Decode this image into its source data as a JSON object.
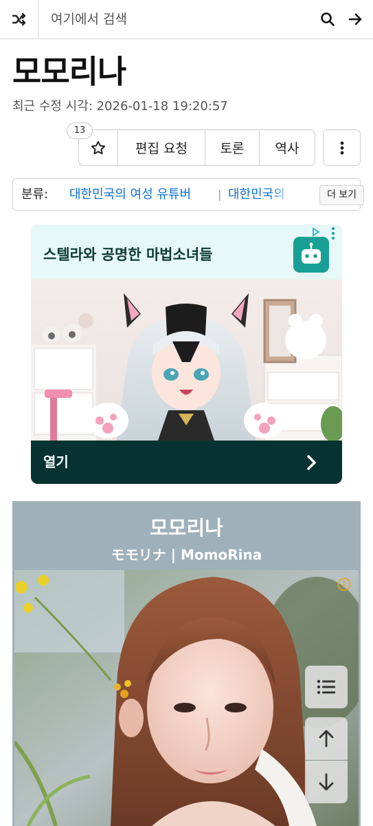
{
  "search": {
    "placeholder": "여기에서 검색"
  },
  "page": {
    "title": "모모리나",
    "last_modified": "최근 수정 시각: 2026-01-18 19:20:57"
  },
  "actions": {
    "star_count": "13",
    "edit_request": "편집 요청",
    "discussion": "토론",
    "history": "역사"
  },
  "category": {
    "label": "분류:",
    "items": [
      "대한민국의 여성 유튜버",
      "대한민국의"
    ],
    "separator": "|",
    "more": "더 보기"
  },
  "ad": {
    "title": "스텔라와 공명한 마법소녀들",
    "cta": "열기"
  },
  "infobox": {
    "name": "모모리나",
    "subtitle": "モモリナ | MomoRina"
  },
  "icons": [
    "shuffle-icon",
    "search-icon",
    "arrow-right-icon",
    "star-icon",
    "more-vertical-icon",
    "robot-icon",
    "chevron-right-icon",
    "info-icon",
    "list-icon",
    "arrow-up-icon",
    "arrow-down-icon"
  ],
  "colors": {
    "link": "#0a6fd6",
    "ad_accent": "#19a095",
    "ad_bar": "#063331",
    "infobox_header": "#9fb0ba"
  }
}
